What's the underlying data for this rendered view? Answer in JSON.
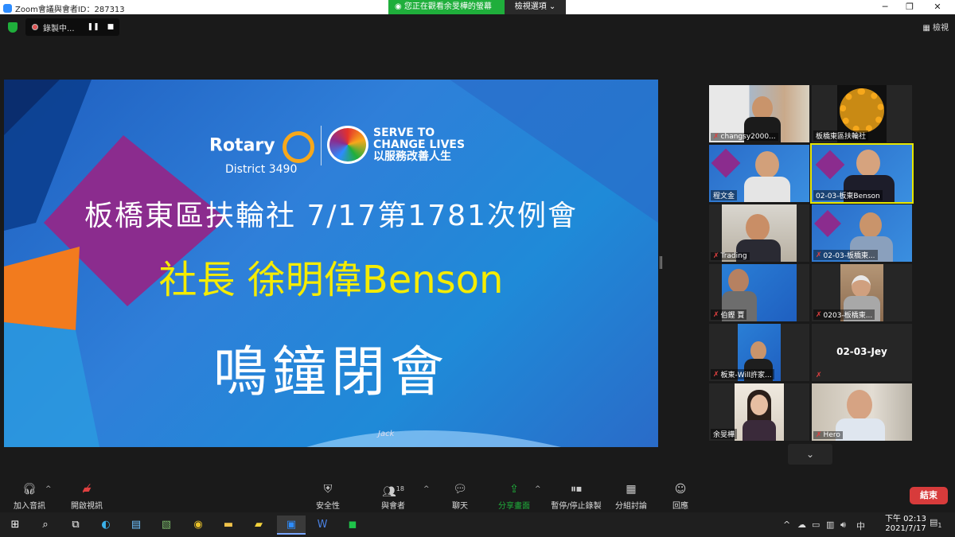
{
  "window": {
    "title": "Zoom會議與會者ID：287313",
    "minimize": "─",
    "maximize": "❐",
    "close": "✕"
  },
  "banner": {
    "viewing": "您正在觀看余旻樺的螢幕",
    "view_options": "檢視選項 ⌄"
  },
  "recording": {
    "label": "錄製中...",
    "pause": "❚❚",
    "stop": "■"
  },
  "view_button": "▦ 檢視",
  "slide": {
    "rotary": "Rotary",
    "district": "District 3490",
    "serve_line1": "SERVE TO",
    "serve_line2": "CHANGE LIVES",
    "serve_line3": "以服務改善人生",
    "line1": "板橋東區扶輪社 7/17第1781次例會",
    "line2": "社長 徐明偉Benson",
    "line3": "鳴鐘閉會",
    "signature": "Jack"
  },
  "participants": [
    {
      "name": "changsy2000...",
      "muted": true
    },
    {
      "name": "板橋東區扶輪社",
      "muted": false
    },
    {
      "name": "程文金",
      "muted": false
    },
    {
      "name": "02-03-板東Benson",
      "muted": false,
      "active_speaker": true
    },
    {
      "name": "Trading",
      "muted": true
    },
    {
      "name": "02-03-板橋東...",
      "muted": true
    },
    {
      "name": "伯鏗 賈",
      "muted": true
    },
    {
      "name": "0203-板橋東...",
      "muted": true
    },
    {
      "name": "板東-Will許家...",
      "muted": true
    },
    {
      "name": "02-03-Jey",
      "muted": true,
      "video_off": true
    },
    {
      "name": "余旻樺",
      "muted": false
    },
    {
      "name": "Hero",
      "muted": true
    }
  ],
  "toolbar": {
    "join_audio": "加入音訊",
    "start_video": "開啟視訊",
    "security": "安全性",
    "participants": "與會者",
    "participant_count": "18",
    "chat": "聊天",
    "share_screen": "分享畫面",
    "pause_record": "暫停/停止錄製",
    "breakout": "分組討論",
    "reactions": "回應",
    "end": "結束"
  },
  "taskbar": {
    "time": "下午 02:13",
    "date": "2021/7/17",
    "ime": "中",
    "notification_count": "1"
  },
  "colors": {
    "accent_green": "#1fae3b",
    "end_red": "#d73b3b",
    "active_border": "#e6e600",
    "slide_yellow": "#f5ec00"
  }
}
